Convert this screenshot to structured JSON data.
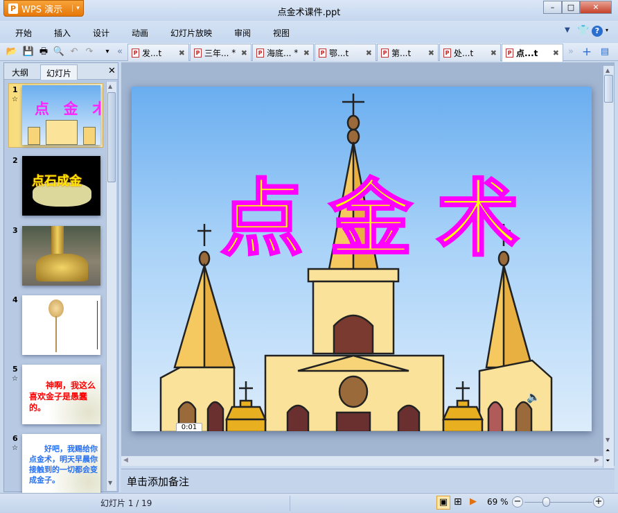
{
  "app": {
    "name": "WPS 演示",
    "doc_title": "点金术课件.ppt"
  },
  "window_controls": {
    "minimize": "–",
    "maximize": "□",
    "close": "✕"
  },
  "menu": [
    "开始",
    "插入",
    "设计",
    "动画",
    "幻灯片放映",
    "审阅",
    "视图"
  ],
  "doc_tabs": [
    {
      "label": "发...t",
      "modified": ""
    },
    {
      "label": "三年...",
      "modified": "*"
    },
    {
      "label": "海底...",
      "modified": "*"
    },
    {
      "label": "鄂...t",
      "modified": ""
    },
    {
      "label": "第...t",
      "modified": ""
    },
    {
      "label": "处...t",
      "modified": ""
    },
    {
      "label": "点...t",
      "modified": "",
      "active": true
    }
  ],
  "panel": {
    "tab_outline": "大纲",
    "tab_slides": "幻灯片",
    "close": "✕"
  },
  "thumbnails": [
    {
      "num": "1",
      "star": "☆",
      "text": "点  金  术"
    },
    {
      "num": "2",
      "star": "",
      "text": "点石成金"
    },
    {
      "num": "3",
      "star": "",
      "text": ""
    },
    {
      "num": "4",
      "star": "",
      "text": ""
    },
    {
      "num": "5",
      "star": "☆",
      "text": "神啊，我这么喜欢金子是愚蠢的。"
    },
    {
      "num": "6",
      "star": "☆",
      "text": "好吧，我赐给你点金术，明天早晨你接触到的一切都会变成金子。"
    }
  ],
  "slide": {
    "title_chars": [
      "点",
      "金",
      "术"
    ],
    "media_time": "0:01",
    "title_fill": "#ffff00",
    "title_stroke": "#ff00ff"
  },
  "notes_placeholder": "单击添加备注",
  "status": {
    "slide_counter": "幻灯片 1 / 19",
    "zoom": "69 %",
    "zoom_level": 0.69
  }
}
